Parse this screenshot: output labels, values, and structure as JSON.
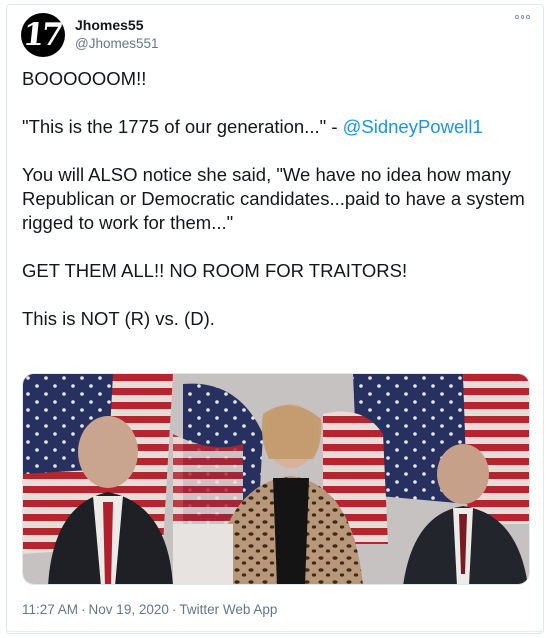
{
  "author": {
    "display_name": "Jhomes55",
    "handle": "@Jhomes551",
    "avatar_text": "17",
    "avatar_icon": "avatar-logo-icon"
  },
  "menu": {
    "icon": "more-options-icon"
  },
  "tweet": {
    "line1": "BOOOOOOM!!",
    "line2_text": "\"This is the 1775 of our generation...\" - ",
    "line2_mention": "@SidneyPowell1",
    "line3": "You will ALSO notice she said, \"We have no idea how many Republican or Democratic candidates...paid to have a system rigged to work for them...\"",
    "line4": "GET THEM ALL!! NO ROOM FOR TRAITORS!",
    "line5": "This is NOT (R) vs. (D)."
  },
  "media": {
    "type": "video-still",
    "description_icon": "press-conference-image"
  },
  "meta": {
    "time": "11:27 AM",
    "separator": "·",
    "date": "Nov 19, 2020",
    "source": "Twitter Web App"
  },
  "colors": {
    "link": "#1b95e0",
    "secondary_text": "#657786",
    "border": "#e1e8ed"
  }
}
